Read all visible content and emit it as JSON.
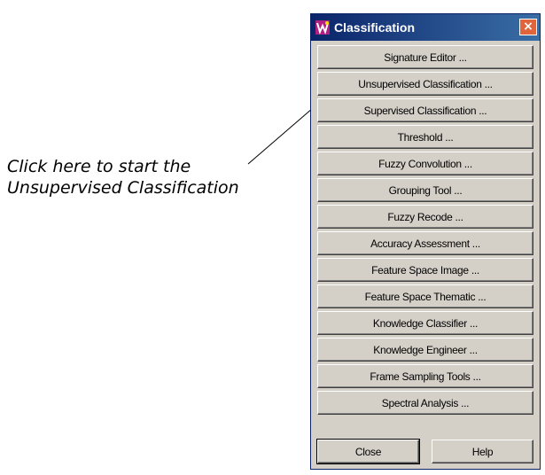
{
  "callout": {
    "line1": "Click here to start the",
    "line2": "Unsupervised Classification"
  },
  "window": {
    "title": "Classification",
    "app_icon": "erdas-app-icon",
    "close_glyph": "×"
  },
  "buttons": [
    {
      "label": "Signature Editor ..."
    },
    {
      "label": "Unsupervised Classification ..."
    },
    {
      "label": "Supervised Classification ..."
    },
    {
      "label": "Threshold ..."
    },
    {
      "label": "Fuzzy Convolution ..."
    },
    {
      "label": "Grouping Tool ..."
    },
    {
      "label": "Fuzzy Recode ..."
    },
    {
      "label": "Accuracy Assessment ..."
    },
    {
      "label": "Feature Space Image ..."
    },
    {
      "label": "Feature Space Thematic ..."
    },
    {
      "label": "Knowledge Classifier ..."
    },
    {
      "label": "Knowledge Engineer ..."
    },
    {
      "label": "Frame Sampling Tools ..."
    },
    {
      "label": "Spectral Analysis ..."
    }
  ],
  "footer": {
    "close_label": "Close",
    "help_label": "Help"
  },
  "colors": {
    "titlebar": "#0a246a",
    "face": "#d4d0c8",
    "close_box": "#e0643c"
  }
}
